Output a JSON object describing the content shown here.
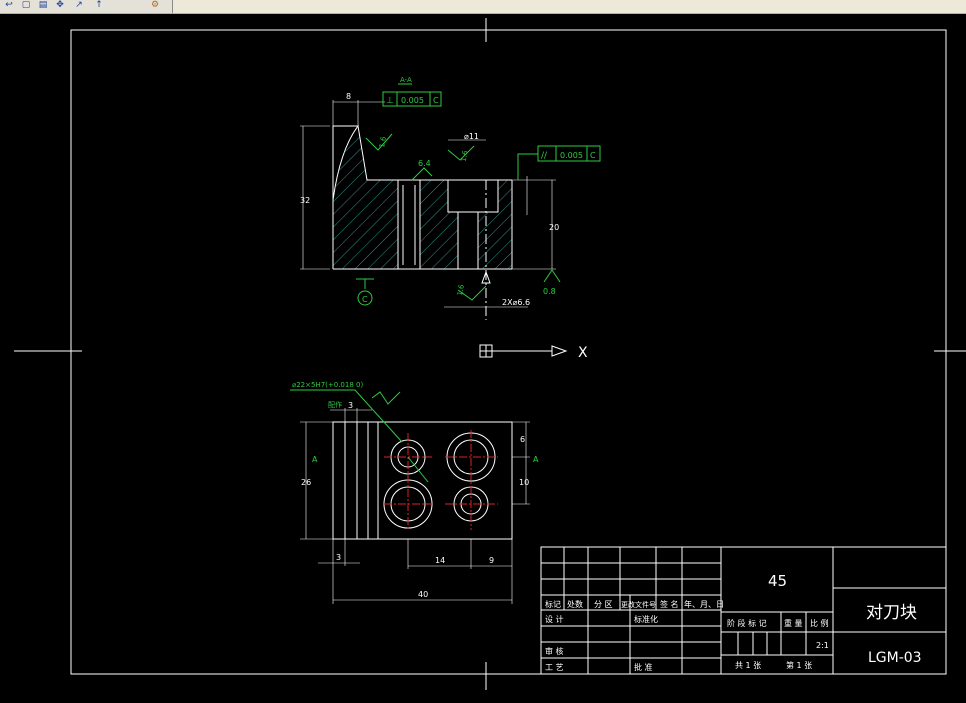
{
  "toolbar": {
    "buttons": [
      {
        "name": "undo-icon",
        "glyph": "↩"
      },
      {
        "name": "save-icon",
        "glyph": "▢"
      },
      {
        "name": "open-icon",
        "glyph": "▤"
      },
      {
        "name": "move-icon",
        "glyph": "✥"
      },
      {
        "name": "dimension-icon",
        "glyph": "↗"
      },
      {
        "name": "pointer-icon",
        "glyph": "↑"
      },
      {
        "name": "plugin-icon",
        "glyph": "⚙"
      }
    ]
  },
  "drawing": {
    "dims": {
      "top_left": "8",
      "height_32": "32",
      "width_11": "⌀11",
      "height_20": "20",
      "spacing": "2X⌀6.6",
      "side_6": "6",
      "side_10": "10",
      "height_26": "26",
      "left_3": "3",
      "bottom_14": "14",
      "bottom_9": "9",
      "width_40": "40",
      "top_3": "3"
    },
    "tolerances": {
      "perp": {
        "symbol": "⊥",
        "value": "0.005",
        "datum": "C"
      },
      "parallel": {
        "symbol": "//",
        "value": "0.005",
        "datum": "C"
      }
    },
    "roughness": {
      "r1": "1.6",
      "r2": "6.4",
      "r3": "1.6",
      "r4": "0.8",
      "r5": "1.6"
    },
    "datum_c": "C",
    "section_label": "A-A",
    "hole_callout": "⌀22×5H7(+0.018 0)",
    "chamfer_label": "配作",
    "cut_a_left": "A",
    "cut_a_right": "A",
    "x_axis": "X"
  },
  "title_block": {
    "material": "45",
    "part_name": "对刀块",
    "drawing_no": "LGM-03",
    "scale": "2:1",
    "row_headers": [
      "标记",
      "处数",
      "分 区",
      "更改文件号",
      "签 名",
      "年、月、日"
    ],
    "design": "设 计",
    "standardize": "标准化",
    "review": "审 核",
    "process": "工 艺",
    "approve": "批 准",
    "stage": "阶 段 标 记",
    "weight": "重 量",
    "ratio": "比 例",
    "sheets_total": "共 1  张",
    "sheet_no": "第  1 张"
  }
}
